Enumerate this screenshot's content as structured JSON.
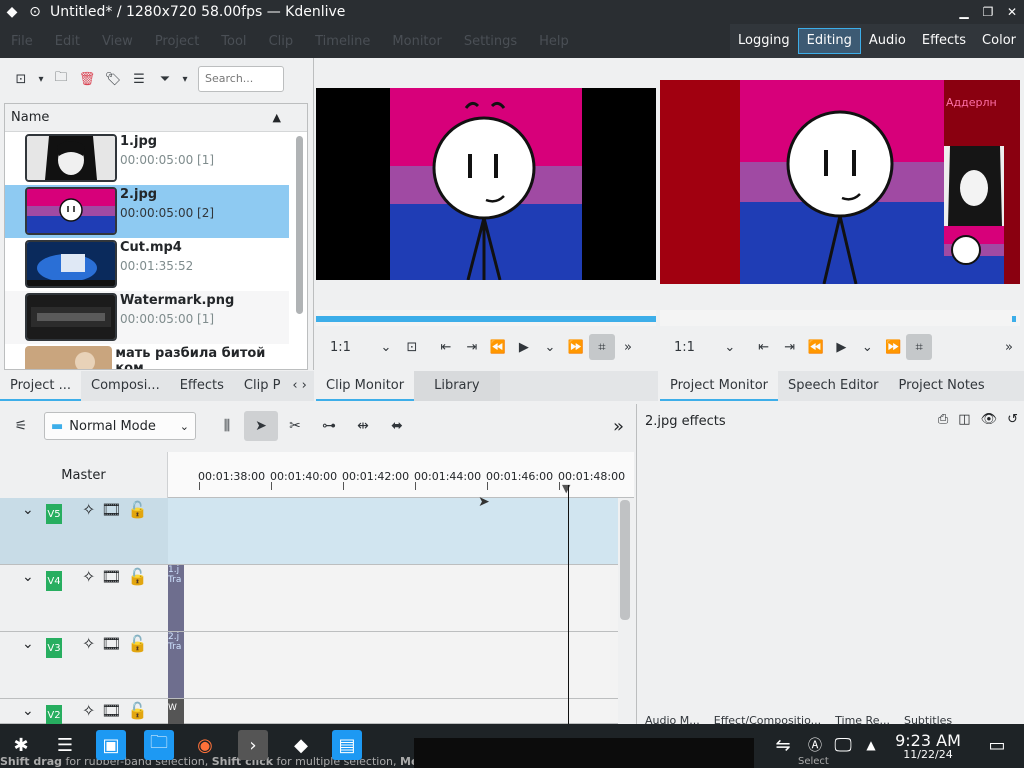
{
  "window": {
    "title": "Untitled* / 1280x720 58.00fps — Kdenlive"
  },
  "menu": [
    "File",
    "Edit",
    "View",
    "Project",
    "Tool",
    "Clip",
    "Timeline",
    "Monitor",
    "Settings",
    "Help"
  ],
  "layouts": [
    {
      "label": "Logging",
      "active": false
    },
    {
      "label": "Editing",
      "active": true
    },
    {
      "label": "Audio",
      "active": false
    },
    {
      "label": "Effects",
      "active": false
    },
    {
      "label": "Color",
      "active": false
    }
  ],
  "bin": {
    "search_placeholder": "Search...",
    "column_name": "Name",
    "clips": [
      {
        "name": "1.jpg",
        "duration": "00:00:05:00 [1]",
        "selected": false
      },
      {
        "name": "2.jpg",
        "duration": "00:00:05:00 [2]",
        "selected": true
      },
      {
        "name": "Cut.mp4",
        "duration": "00:01:35:52",
        "selected": false
      },
      {
        "name": "Watermark.png",
        "duration": "00:00:05:00 [1]",
        "selected": false
      },
      {
        "name": "мать разбила битой ком",
        "duration": "",
        "selected": false
      }
    ],
    "tabs": [
      "Project ...",
      "Composi...",
      "Effects",
      "Clip P"
    ]
  },
  "clip_monitor": {
    "zoom": "1:1",
    "tabs": [
      "Clip Monitor",
      "Library"
    ]
  },
  "project_monitor": {
    "zoom": "1:1",
    "overlay_text": "Аддерлн",
    "tabs": [
      "Project Monitor",
      "Speech Editor",
      "Project Notes"
    ]
  },
  "timeline": {
    "mode": "Normal Mode",
    "master_label": "Master",
    "ruler_labels": [
      "00:01:38:00",
      "00:01:40:00",
      "00:01:42:00",
      "00:01:44:00",
      "00:01:46:00",
      "00:01:48:00"
    ],
    "tracks": [
      {
        "name": "V5",
        "selected": true,
        "clip_label": ""
      },
      {
        "name": "V4",
        "selected": false,
        "clip_label": "1.j Tra"
      },
      {
        "name": "V3",
        "selected": false,
        "clip_label": "2.j Tra"
      },
      {
        "name": "V2",
        "selected": false,
        "clip_label": "W"
      }
    ]
  },
  "effects_panel": {
    "title": "2.jpg effects",
    "bottom_tabs": [
      "Audio M...",
      "Effect/Compositio...",
      "Time Re...",
      "Subtitles"
    ]
  },
  "status": {
    "hint_bold1": "Shift drag",
    "hint1": " for rubber-band selection, ",
    "hint_bold2": "Shift click",
    "hint2": " for multiple selection, ",
    "hint_bold3": "Meta+A"
  },
  "taskbar": {
    "time": "9:23 AM",
    "date": "11/22/24",
    "select_label": "Select"
  }
}
